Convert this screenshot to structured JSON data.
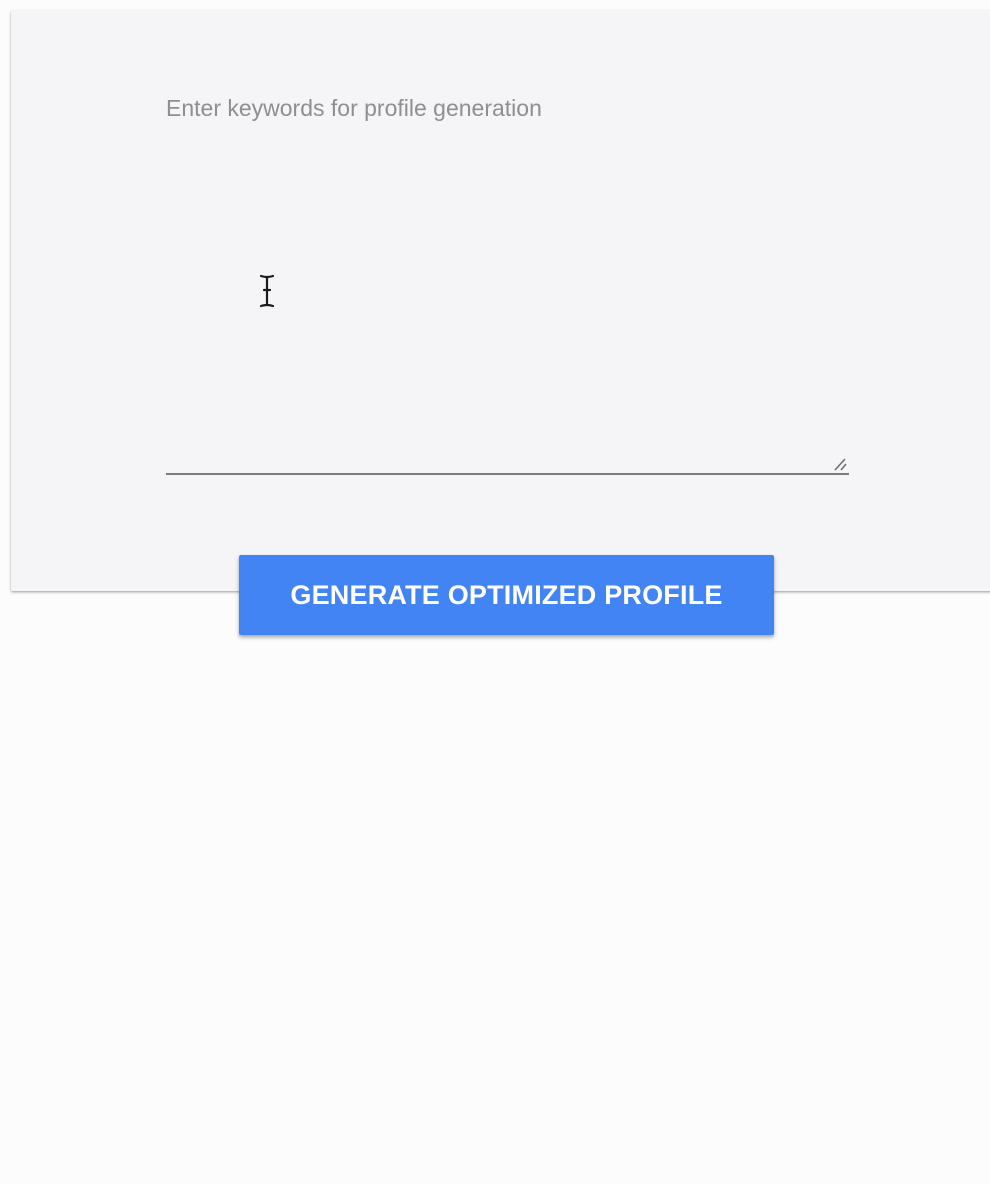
{
  "form": {
    "keywords_label": "Enter keywords for profile generation",
    "keywords_value": "",
    "generate_button_label": "GENERATE OPTIMIZED PROFILE"
  },
  "colors": {
    "page_background": "#fdfcfd",
    "card_background": "#f5f4f6",
    "button_background": "#4284f4",
    "button_text": "#ffffff",
    "label_text": "#8e8e93",
    "underline": "#7a7a7e"
  },
  "icons": {
    "text_cursor": "i-beam-cursor-icon",
    "resize_handle": "resize-handle-icon"
  }
}
